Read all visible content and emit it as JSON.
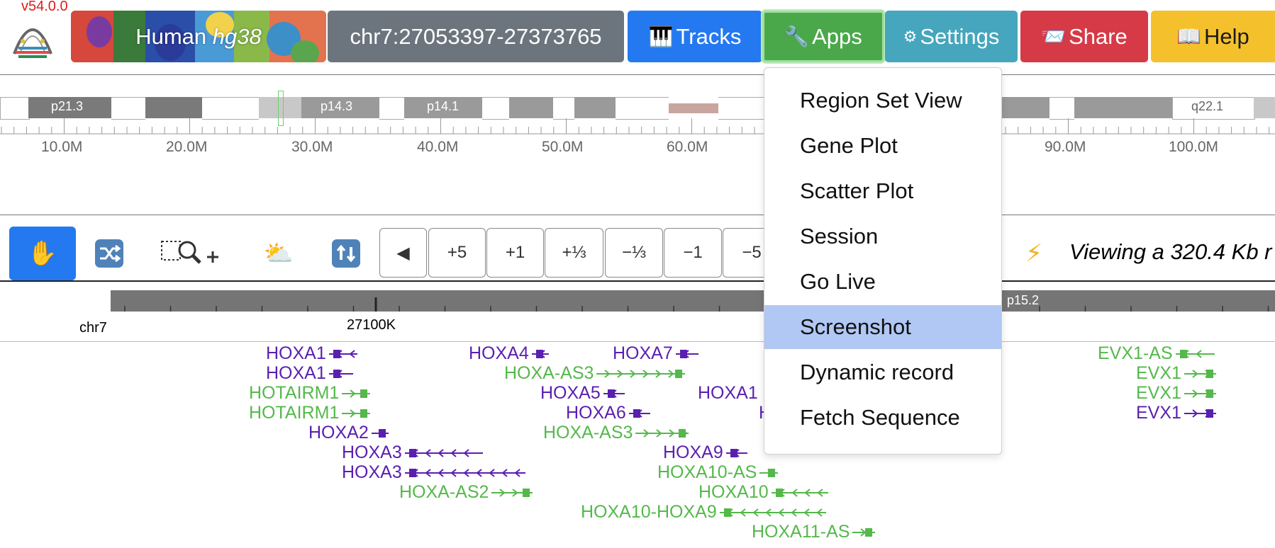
{
  "header": {
    "version": "v54.0.0",
    "genome_label_prefix": "Human ",
    "genome_label_assembly": "hg38",
    "locus": "chr7:27053397-27373765",
    "tracks_label": "Tracks",
    "apps_label": "Apps",
    "settings_label": "Settings",
    "share_label": "Share",
    "help_label": "Help"
  },
  "ideogram": {
    "bands": [
      "p21.3",
      "p14.3",
      "p14.1",
      "q22.1"
    ],
    "ticks": [
      "10.0M",
      "20.0M",
      "30.0M",
      "40.0M",
      "50.0M",
      "60.0M",
      "90.0M",
      "100.0M"
    ]
  },
  "toolbar": {
    "zoom_buttons": [
      "◀",
      "+5",
      "+1",
      "+⅓",
      "−⅓",
      "−1",
      "−5"
    ],
    "status": "Viewing a 320.4 Kb r"
  },
  "track": {
    "chrom": "chr7",
    "position_label": "27100K",
    "band_label": "p15.2"
  },
  "genes": [
    {
      "name": "HOXA1",
      "color": "purple"
    },
    {
      "name": "HOXA1",
      "color": "purple"
    },
    {
      "name": "HOTAIRM1",
      "color": "green"
    },
    {
      "name": "HOTAIRM1",
      "color": "green"
    },
    {
      "name": "HOXA2",
      "color": "purple"
    },
    {
      "name": "HOXA3",
      "color": "purple"
    },
    {
      "name": "HOXA3",
      "color": "purple"
    },
    {
      "name": "HOXA-AS2",
      "color": "green"
    },
    {
      "name": "HOXA4",
      "color": "purple"
    },
    {
      "name": "HOXA-AS3",
      "color": "green"
    },
    {
      "name": "HOXA5",
      "color": "purple"
    },
    {
      "name": "HOXA6",
      "color": "purple"
    },
    {
      "name": "HOXA-AS3",
      "color": "green"
    },
    {
      "name": "HOXA7",
      "color": "purple"
    },
    {
      "name": "HOXA9",
      "color": "purple"
    },
    {
      "name": "HOXA10-AS",
      "color": "green"
    },
    {
      "name": "HOXA10",
      "color": "green"
    },
    {
      "name": "HOXA10-HOXA9",
      "color": "green"
    },
    {
      "name": "HOXA11-AS",
      "color": "green"
    },
    {
      "name": "HOXA1",
      "color": "purple"
    },
    {
      "name": "H",
      "color": "purple"
    },
    {
      "name": "EVX1-AS",
      "color": "green"
    },
    {
      "name": "EVX1",
      "color": "green"
    },
    {
      "name": "EVX1",
      "color": "green"
    },
    {
      "name": "EVX1",
      "color": "purple"
    }
  ],
  "apps_menu": {
    "items": [
      "Region Set View",
      "Gene Plot",
      "Scatter Plot",
      "Session",
      "Go Live",
      "Screenshot",
      "Dynamic record",
      "Fetch Sequence"
    ],
    "selected": "Screenshot"
  },
  "colors": {
    "gene_purple": "#5a1fb0",
    "gene_green": "#55b84b",
    "menu_highlight": "#b1c7f4"
  }
}
